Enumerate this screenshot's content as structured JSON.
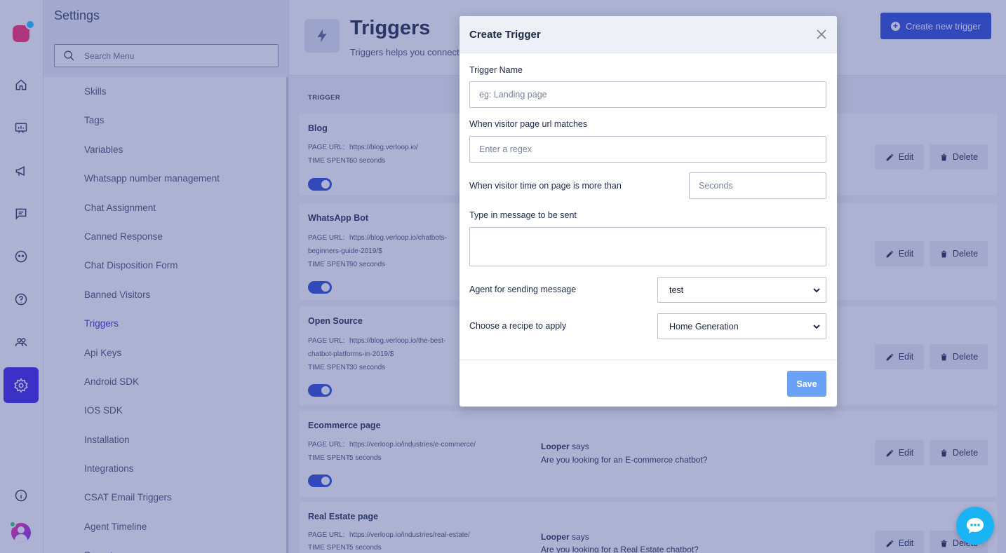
{
  "settings": {
    "title": "Settings",
    "search_placeholder": "Search Menu",
    "items": [
      {
        "label": "Skills"
      },
      {
        "label": "Tags"
      },
      {
        "label": "Variables"
      },
      {
        "label": "Whatsapp number management"
      },
      {
        "label": "Chat Assignment"
      },
      {
        "label": "Canned Response"
      },
      {
        "label": "Chat Disposition Form"
      },
      {
        "label": "Banned Visitors"
      },
      {
        "label": "Triggers"
      },
      {
        "label": "Api Keys"
      },
      {
        "label": "Android SDK"
      },
      {
        "label": "IOS SDK"
      },
      {
        "label": "Installation"
      },
      {
        "label": "Integrations"
      },
      {
        "label": "CSAT Email Triggers"
      },
      {
        "label": "Agent Timeline"
      },
      {
        "label": "Reports"
      }
    ],
    "active": "Triggers"
  },
  "page": {
    "title": "Triggers",
    "subtitle": "Triggers helps you connect",
    "create_label": "Create new trigger",
    "column_header": "TRIGGER"
  },
  "labels": {
    "page_url": "PAGE URL:",
    "time_spent": "TIME SPENT:",
    "says": "says",
    "edit": "Edit",
    "delete": "Delete"
  },
  "triggers": [
    {
      "name": "Blog",
      "url": "https://blog.verloop.io/",
      "time": "60 seconds",
      "agent": "",
      "message": ""
    },
    {
      "name": "WhatsApp Bot",
      "url": "https://blog.verloop.io/chatbots-",
      "url2": "beginners-guide-2019/$",
      "time": "90 seconds",
      "agent": "",
      "message": ""
    },
    {
      "name": "Open Source",
      "url": "https://blog.verloop.io/the-best-",
      "url2": "chatbot-platforms-in-2019/$",
      "time": "30 seconds",
      "agent": "",
      "message": ""
    },
    {
      "name": "Ecommerce page",
      "url": "https://verloop.io/industries/e-commerce/",
      "time": "5 seconds",
      "agent": "Looper",
      "message": "Are you looking for an E-commerce chatbot?"
    },
    {
      "name": "Real Estate page",
      "url": "https://verloop.io/industries/real-estate/",
      "time": "5 seconds",
      "agent": "Looper",
      "message": "Are you looking for a Real Estate chatbot?"
    }
  ],
  "modal": {
    "title": "Create Trigger",
    "trigger_name_label": "Trigger Name",
    "trigger_name_placeholder": "eg: Landing page",
    "url_label": "When visitor page url matches",
    "url_placeholder": "Enter a regex",
    "time_label": "When visitor time on page is more than",
    "time_placeholder": "Seconds",
    "message_label": "Type in message to be sent",
    "agent_label": "Agent for sending message",
    "agent_value": "test",
    "recipe_label": "Choose a recipe to apply",
    "recipe_value": "Home Generation",
    "save_label": "Save"
  },
  "colors": {
    "accent": "#3b22e8",
    "primary_button": "#2a4bd6",
    "save_button": "#6aa2f8",
    "chat_widget": "#1ab4f5",
    "overlay": "#3c4896"
  }
}
